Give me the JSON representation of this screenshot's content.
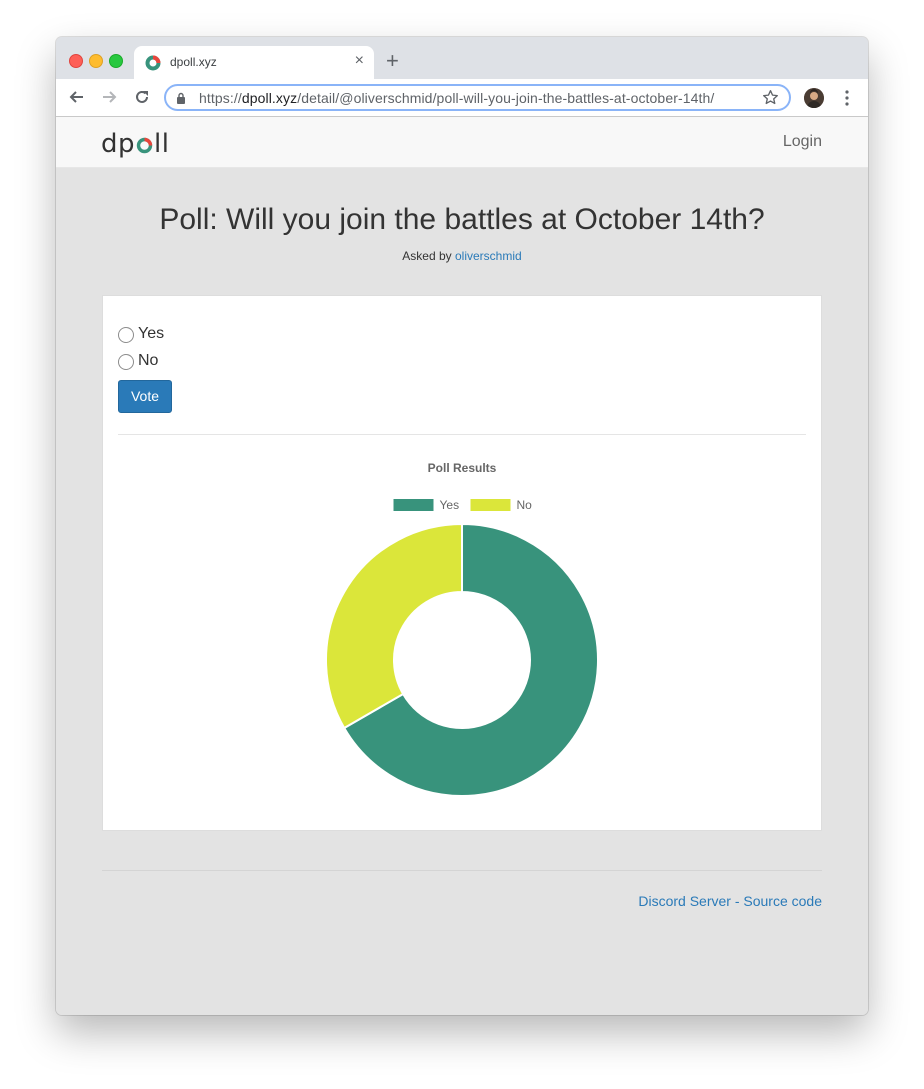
{
  "browser": {
    "tab_title": "dpoll.xyz",
    "tab_close": "×",
    "new_tab": "+",
    "url_scheme": "https://",
    "url_domain": "dpoll.xyz",
    "url_path": "/detail/@oliverschmid/poll-will-you-join-the-battles-at-october-14th/"
  },
  "navbar": {
    "logo_left": "dp",
    "logo_right": "ll",
    "login_label": "Login"
  },
  "poll": {
    "title": "Poll: Will you join the battles at October 14th?",
    "asked_by_prefix": "Asked by",
    "author": "oliverschmid",
    "options": [
      "Yes",
      "No"
    ],
    "vote_label": "Vote"
  },
  "chart_data": {
    "type": "pie",
    "title": "Poll Results",
    "categories": [
      "Yes",
      "No"
    ],
    "values": [
      2,
      1
    ],
    "colors": [
      "#38937c",
      "#dbe63a"
    ],
    "legend": "top",
    "donut": true
  },
  "footer": {
    "discord_label": "Discord Server",
    "separator": "-",
    "source_label": "Source code"
  }
}
